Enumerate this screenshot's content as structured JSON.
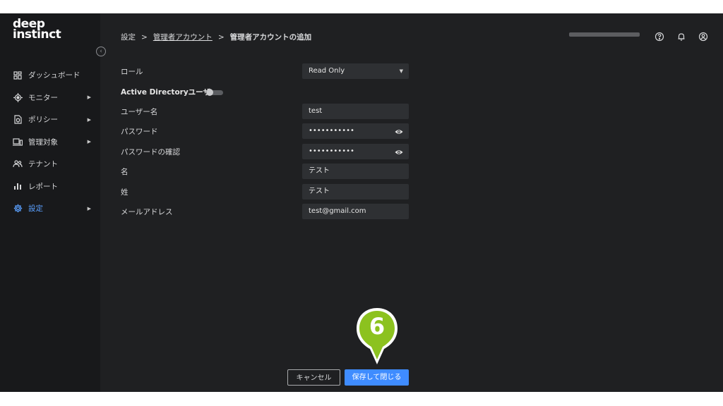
{
  "app": {
    "logo_line1": "deep",
    "logo_line2": "instinct"
  },
  "sidebar": {
    "collapse_icon": "chevron-left-icon",
    "items": [
      {
        "label": "ダッシュボード",
        "icon": "dashboard-icon",
        "has_arrow": false,
        "active": false
      },
      {
        "label": "モニター",
        "icon": "target-icon",
        "has_arrow": true,
        "active": false
      },
      {
        "label": "ポリシー",
        "icon": "policy-icon",
        "has_arrow": true,
        "active": false
      },
      {
        "label": "管理対象",
        "icon": "devices-icon",
        "has_arrow": true,
        "active": false
      },
      {
        "label": "テナント",
        "icon": "people-icon",
        "has_arrow": false,
        "active": false
      },
      {
        "label": "レポート",
        "icon": "bar-chart-icon",
        "has_arrow": false,
        "active": false
      },
      {
        "label": "設定",
        "icon": "gear-icon",
        "has_arrow": true,
        "active": true
      }
    ]
  },
  "breadcrumb": {
    "root": "設定",
    "parent": "管理者アカウント",
    "current": "管理者アカウントの追加",
    "separator": ">"
  },
  "header": {
    "icons": [
      "help-icon",
      "bell-icon",
      "account-icon"
    ]
  },
  "form": {
    "role": {
      "label": "ロール",
      "value": "Read Only"
    },
    "active_directory": {
      "label": "Active Directoryユーザー",
      "enabled": false
    },
    "username": {
      "label": "ユーザー名",
      "value": "test"
    },
    "password": {
      "label": "パスワード",
      "value": "•••••••••••"
    },
    "password_confirm": {
      "label": "パスワードの確認",
      "value": "•••••••••••"
    },
    "first_name": {
      "label": "名",
      "value": "テスト"
    },
    "last_name": {
      "label": "姓",
      "value": "テスト"
    },
    "email": {
      "label": "メールアドレス",
      "value": "test@gmail.com"
    }
  },
  "actions": {
    "cancel_label": "キャンセル",
    "save_label": "保存して閉じる"
  },
  "callout": {
    "number": "6",
    "color": "#8cc21f"
  },
  "colors": {
    "accent": "#3f8cff",
    "background": "#1f2022",
    "sidebar": "#18191b",
    "field": "#2e3033"
  }
}
